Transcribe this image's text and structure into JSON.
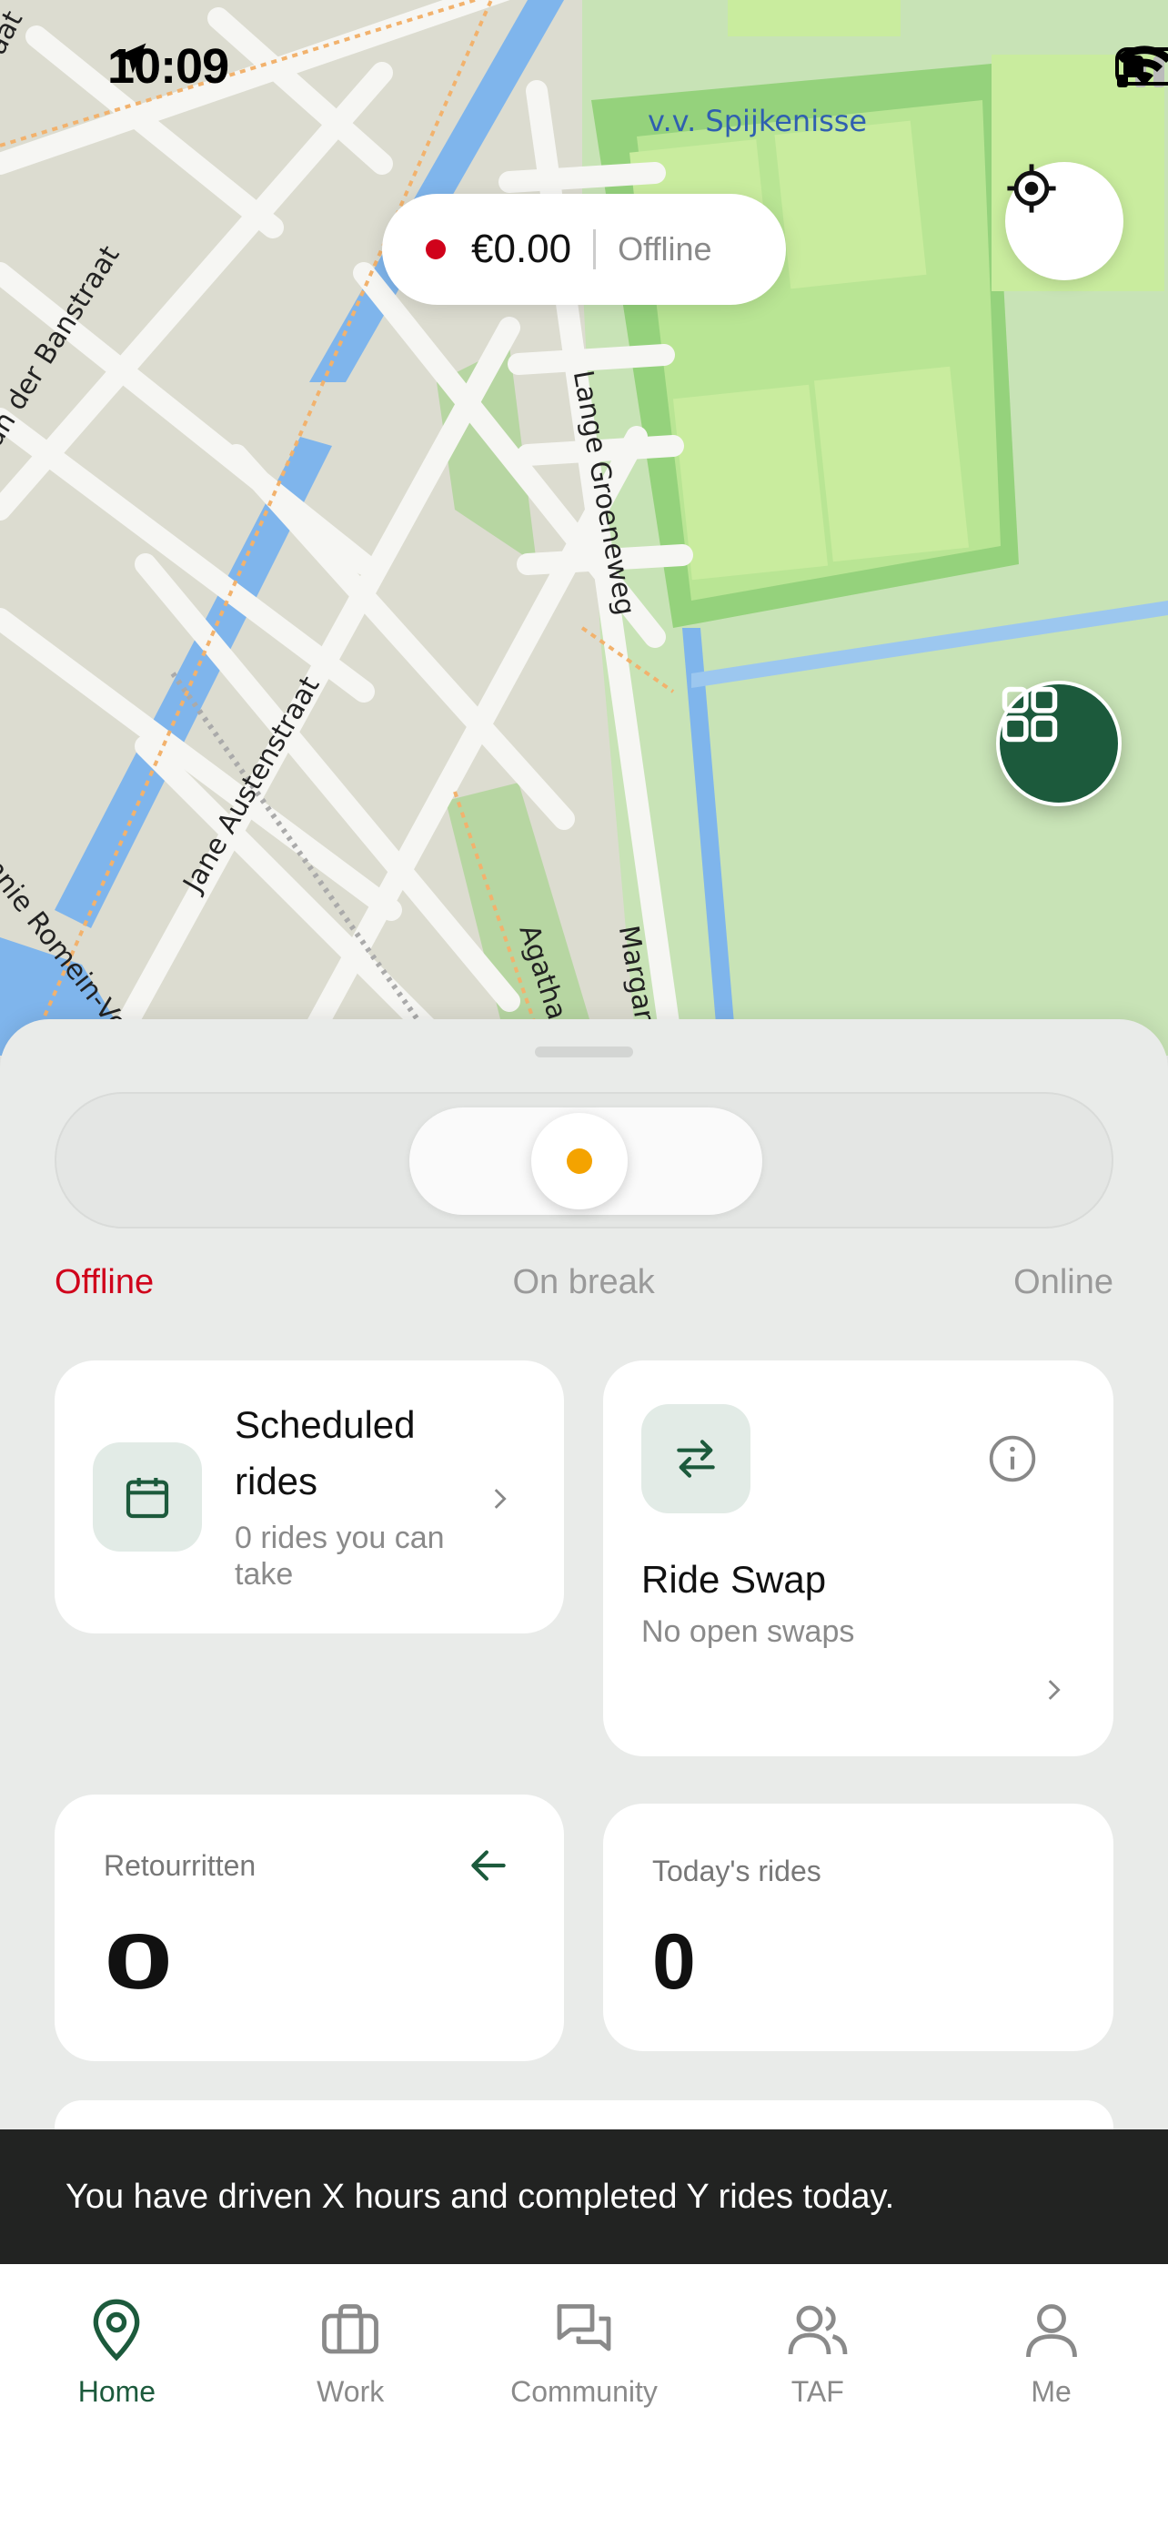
{
  "status_bar": {
    "time": "10:09"
  },
  "map": {
    "streets": [
      "an der Banstraat",
      "Jane Austenstraat",
      "Lange Groeneweg",
      "Agatha Christi",
      "Margaret Mitch",
      "nnie Romein-Ve",
      "aat"
    ],
    "poi": "v.v. Spijkenisse"
  },
  "balance": {
    "amount": "€0.00",
    "status": "Offline"
  },
  "status_slider": {
    "offline": "Offline",
    "on_break": "On break",
    "online": "Online"
  },
  "cards": {
    "scheduled": {
      "title": "Scheduled rides",
      "subtitle": "0 rides you can take"
    },
    "swap": {
      "title": "Ride Swap",
      "subtitle": "No open swaps"
    },
    "retour": {
      "label": "Retourritten",
      "value": "0"
    },
    "today": {
      "label": "Today's rides",
      "value": "0"
    }
  },
  "banner": {
    "text": "You have driven X hours and completed Y rides today."
  },
  "tabs": [
    {
      "label": "Home",
      "icon": "map-pin-icon"
    },
    {
      "label": "Work",
      "icon": "briefcase-icon"
    },
    {
      "label": "Community",
      "icon": "chat-icon"
    },
    {
      "label": "TAF",
      "icon": "users-icon"
    },
    {
      "label": "Me",
      "icon": "user-icon"
    }
  ],
  "colors": {
    "accent": "#1c5a3c",
    "offline_red": "#d0021b",
    "break_amber": "#f4a300"
  }
}
